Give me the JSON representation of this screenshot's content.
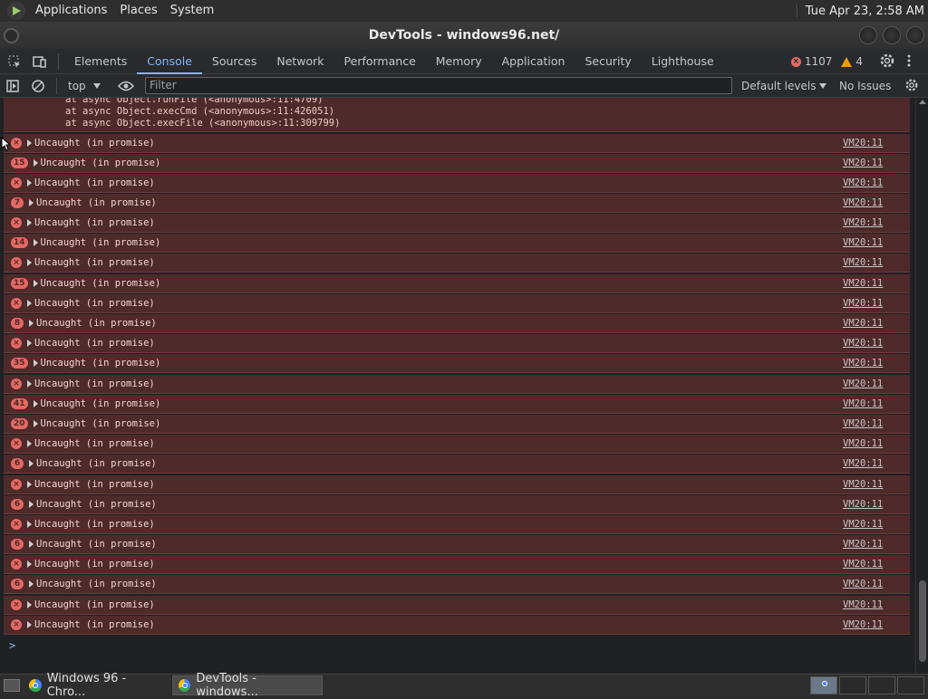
{
  "top_panel": {
    "applications": "Applications",
    "places": "Places",
    "system": "System",
    "clock": "Tue Apr 23,  2:58 AM"
  },
  "window": {
    "title": "DevTools - windows96.net/"
  },
  "devtools": {
    "tabs": [
      "Elements",
      "Console",
      "Sources",
      "Network",
      "Performance",
      "Memory",
      "Application",
      "Security",
      "Lighthouse"
    ],
    "active_tab": "Console",
    "error_count": "1107",
    "warning_count": "4"
  },
  "console_bar": {
    "context": "top",
    "filter_placeholder": "Filter",
    "levels": "Default levels",
    "issues": "No Issues"
  },
  "stack_trace": [
    "at async Object.runFile (<anonymous>:11:4709)",
    "at async Object.execCmd (<anonymous>:11:426051)",
    "at async Object.execFile (<anonymous>:11:309799)"
  ],
  "messages": [
    {
      "badge": "x",
      "text": "Uncaught (in promise)",
      "source": "VM20:11"
    },
    {
      "badge": "15",
      "text": "Uncaught (in promise)",
      "source": "VM20:11"
    },
    {
      "badge": "x",
      "text": "Uncaught (in promise)",
      "source": "VM20:11"
    },
    {
      "badge": "7",
      "text": "Uncaught (in promise)",
      "source": "VM20:11"
    },
    {
      "badge": "x",
      "text": "Uncaught (in promise)",
      "source": "VM20:11"
    },
    {
      "badge": "14",
      "text": "Uncaught (in promise)",
      "source": "VM20:11"
    },
    {
      "badge": "x",
      "text": "Uncaught (in promise)",
      "source": "VM20:11"
    },
    {
      "badge": "15",
      "text": "Uncaught (in promise)",
      "source": "VM20:11"
    },
    {
      "badge": "x",
      "text": "Uncaught (in promise)",
      "source": "VM20:11"
    },
    {
      "badge": "8",
      "text": "Uncaught (in promise)",
      "source": "VM20:11"
    },
    {
      "badge": "x",
      "text": "Uncaught (in promise)",
      "source": "VM20:11"
    },
    {
      "badge": "35",
      "text": "Uncaught (in promise)",
      "source": "VM20:11"
    },
    {
      "badge": "x",
      "text": "Uncaught (in promise)",
      "source": "VM20:11"
    },
    {
      "badge": "41",
      "text": "Uncaught (in promise)",
      "source": "VM20:11"
    },
    {
      "badge": "20",
      "text": "Uncaught (in promise)",
      "source": "VM20:11"
    },
    {
      "badge": "x",
      "text": "Uncaught (in promise)",
      "source": "VM20:11"
    },
    {
      "badge": "6",
      "text": "Uncaught (in promise)",
      "source": "VM20:11"
    },
    {
      "badge": "x",
      "text": "Uncaught (in promise)",
      "source": "VM20:11"
    },
    {
      "badge": "6",
      "text": "Uncaught (in promise)",
      "source": "VM20:11"
    },
    {
      "badge": "x",
      "text": "Uncaught (in promise)",
      "source": "VM20:11"
    },
    {
      "badge": "6",
      "text": "Uncaught (in promise)",
      "source": "VM20:11"
    },
    {
      "badge": "x",
      "text": "Uncaught (in promise)",
      "source": "VM20:11"
    },
    {
      "badge": "6",
      "text": "Uncaught (in promise)",
      "source": "VM20:11"
    },
    {
      "badge": "x",
      "text": "Uncaught (in promise)",
      "source": "VM20:11"
    },
    {
      "badge": "x",
      "text": "Uncaught (in promise)",
      "source": "VM20:11"
    }
  ],
  "prompt": ">",
  "taskbar": {
    "tasks": [
      "Windows 96 - Chro...",
      "DevTools - windows..."
    ]
  },
  "colors": {
    "error_row_bg": "#4e2a2a",
    "error_red": "#e46962",
    "accent_blue": "#8ab4f8",
    "warning_orange": "#f29900"
  }
}
